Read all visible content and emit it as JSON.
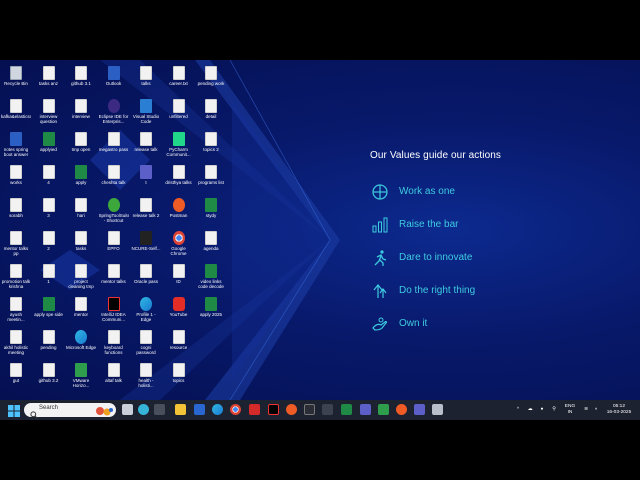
{
  "desktop": {
    "icons": [
      {
        "label": "Recycle Bin",
        "kind": "bin"
      },
      {
        "label": "tasks anz",
        "kind": "file"
      },
      {
        "label": "github 3.1",
        "kind": "file"
      },
      {
        "label": "Outlook",
        "kind": "word"
      },
      {
        "label": "talks",
        "kind": "file"
      },
      {
        "label": "career.txt",
        "kind": "file"
      },
      {
        "label": "pending work",
        "kind": "file"
      },
      {
        "label": "kafka&elasticsc...",
        "kind": "file"
      },
      {
        "label": "interview question",
        "kind": "file"
      },
      {
        "label": "interview",
        "kind": "file"
      },
      {
        "label": "Eclipse IDE for Enterpris...",
        "kind": "eclipse"
      },
      {
        "label": "Visual Studio Code",
        "kind": "vs"
      },
      {
        "label": "unfiltered",
        "kind": "file"
      },
      {
        "label": "detail",
        "kind": "file"
      },
      {
        "label": "notes spring boot answer",
        "kind": "word"
      },
      {
        "label": "applyied",
        "kind": "excel"
      },
      {
        "label": "tmp open",
        "kind": "file"
      },
      {
        "label": "megastro pass",
        "kind": "file"
      },
      {
        "label": "release talk",
        "kind": "file"
      },
      {
        "label": "PyCharm Communit...",
        "kind": "pycharm"
      },
      {
        "label": "topics 2",
        "kind": "file"
      },
      {
        "label": "works",
        "kind": "file"
      },
      {
        "label": "4",
        "kind": "file"
      },
      {
        "label": "apply",
        "kind": "excel"
      },
      {
        "label": "cheshta talk",
        "kind": "file"
      },
      {
        "label": "t",
        "kind": "teams"
      },
      {
        "label": "dristhya talks",
        "kind": "file"
      },
      {
        "label": "programs list",
        "kind": "file"
      },
      {
        "label": "sorabh",
        "kind": "file"
      },
      {
        "label": "3",
        "kind": "file"
      },
      {
        "label": "hari",
        "kind": "file"
      },
      {
        "label": "SpringToolSuite4 - Shortcut",
        "kind": "green"
      },
      {
        "label": "release talk 2",
        "kind": "file"
      },
      {
        "label": "Postman",
        "kind": "postman"
      },
      {
        "label": "stydy",
        "kind": "excel"
      },
      {
        "label": "mentor talks pp",
        "kind": "file"
      },
      {
        "label": "2",
        "kind": "file"
      },
      {
        "label": "tasks",
        "kind": "file"
      },
      {
        "label": "EPFO",
        "kind": "file"
      },
      {
        "label": "NCURE-Self...",
        "kind": "dark"
      },
      {
        "label": "Google Chrome",
        "kind": "chrome"
      },
      {
        "label": "agenda",
        "kind": "file"
      },
      {
        "label": "promotion talk krishna",
        "kind": "file"
      },
      {
        "label": "1",
        "kind": "file"
      },
      {
        "label": "project cleaning tmp",
        "kind": "file"
      },
      {
        "label": "mentor talks",
        "kind": "file"
      },
      {
        "label": "Oracle pass",
        "kind": "file"
      },
      {
        "label": "ID",
        "kind": "file"
      },
      {
        "label": "video links code decode",
        "kind": "excel"
      },
      {
        "label": "ayush meetin...",
        "kind": "file"
      },
      {
        "label": "apply spe side",
        "kind": "excel"
      },
      {
        "label": "mentor",
        "kind": "file"
      },
      {
        "label": "IntelliJ IDEA Communi...",
        "kind": "intellij"
      },
      {
        "label": "Profile 1 - Edge",
        "kind": "edge"
      },
      {
        "label": "YouTube",
        "kind": "yt"
      },
      {
        "label": "apply 2025",
        "kind": "excel"
      },
      {
        "label": "akhil holistic meeting",
        "kind": "file"
      },
      {
        "label": "pending",
        "kind": "file"
      },
      {
        "label": "Microsoft Edge",
        "kind": "edge"
      },
      {
        "label": "keyboard functions",
        "kind": "file"
      },
      {
        "label": "cogni password",
        "kind": "file"
      },
      {
        "label": "resource",
        "kind": "file"
      },
      {
        "label": "",
        "kind": "none"
      },
      {
        "label": "gut",
        "kind": "file"
      },
      {
        "label": "github 3.2",
        "kind": "file"
      },
      {
        "label": "VMware Horizo...",
        "kind": "vmware"
      },
      {
        "label": "altaf talk",
        "kind": "file"
      },
      {
        "label": "health - holisti...",
        "kind": "file"
      },
      {
        "label": "topics",
        "kind": "file"
      },
      {
        "label": "",
        "kind": "none"
      }
    ]
  },
  "values": {
    "title": "Our Values guide our actions",
    "items": [
      {
        "label": "Work as one",
        "icon": "globe-icon"
      },
      {
        "label": "Raise the bar",
        "icon": "bar-chart-icon"
      },
      {
        "label": "Dare to innovate",
        "icon": "runner-icon"
      },
      {
        "label": "Do the right thing",
        "icon": "arrows-up-icon"
      },
      {
        "label": "Own it",
        "icon": "hand-icon"
      }
    ],
    "accent_color": "#3ecbe0"
  },
  "taskbar": {
    "search_placeholder": "Search",
    "tray": {
      "lang_top": "ENG",
      "lang_bottom": "IN",
      "time": "05:12",
      "date": "16-03-2025"
    }
  }
}
